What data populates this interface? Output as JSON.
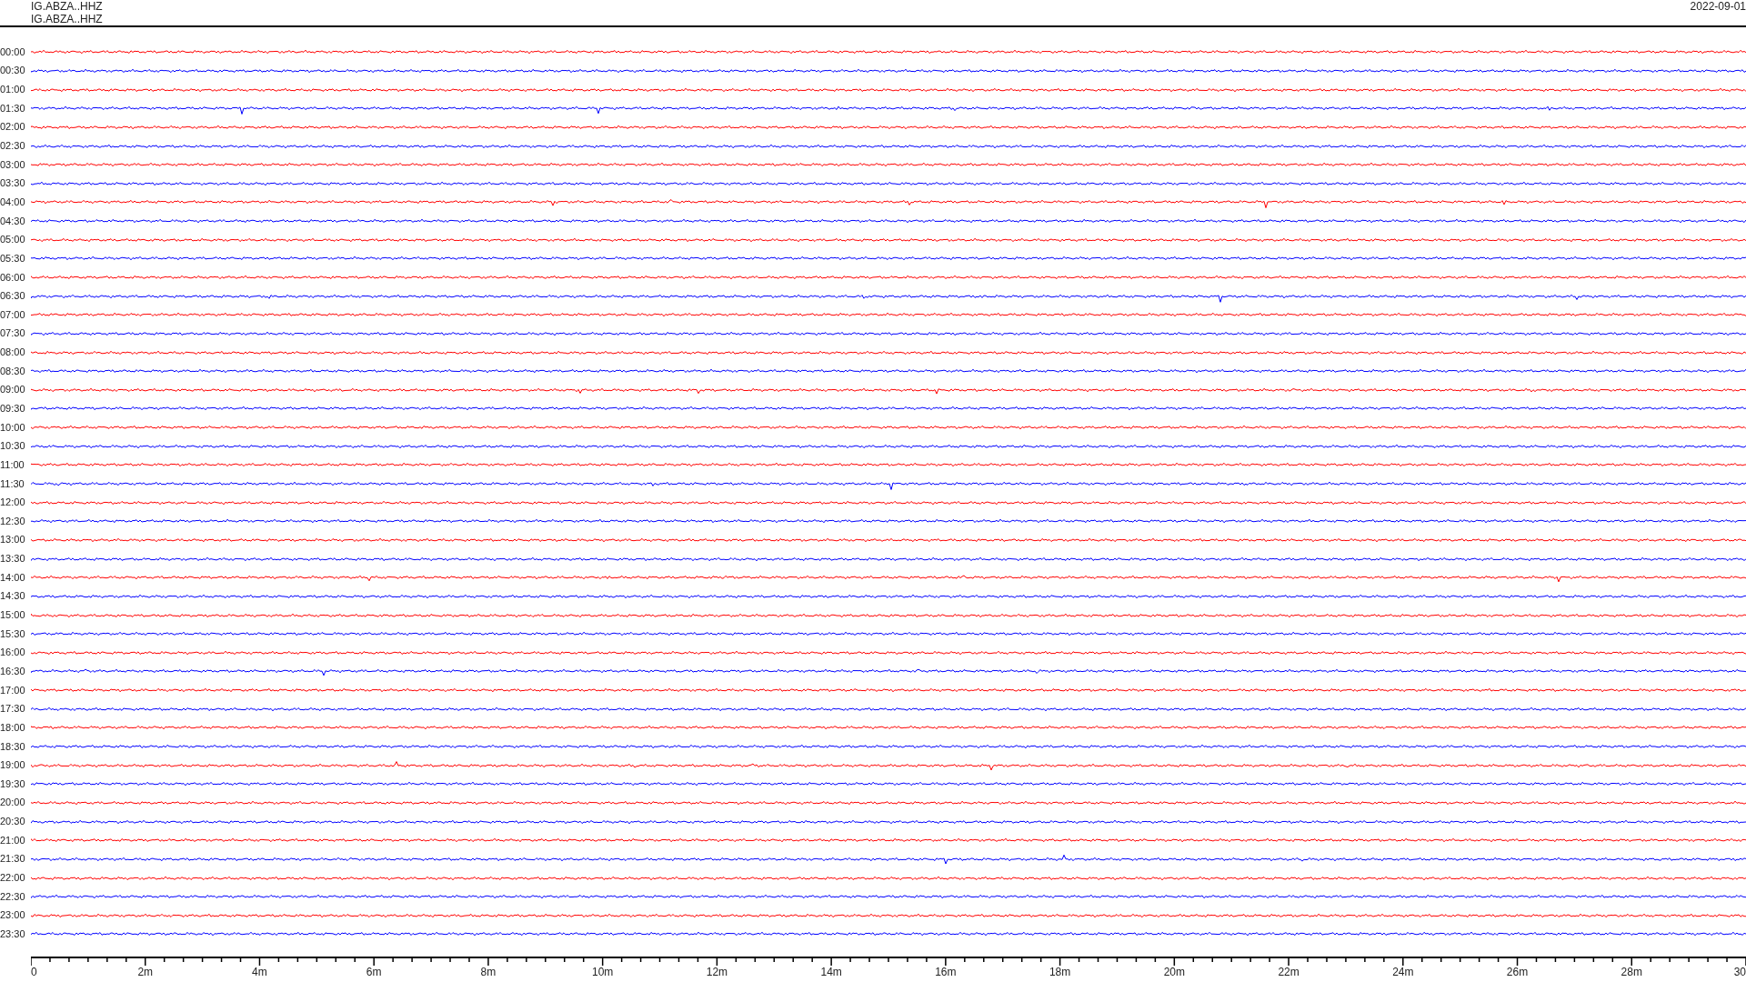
{
  "header": {
    "stations": [
      "IG.ABZA..HHZ",
      "IG.ABZA..HHZ"
    ],
    "date": "2022-09-01"
  },
  "rows": [
    {
      "label": "00:00",
      "color": "#ff0000"
    },
    {
      "label": "00:30",
      "color": "#0000ff"
    },
    {
      "label": "01:00",
      "color": "#ff0000"
    },
    {
      "label": "01:30",
      "color": "#0000ff"
    },
    {
      "label": "02:00",
      "color": "#ff0000"
    },
    {
      "label": "02:30",
      "color": "#0000ff"
    },
    {
      "label": "03:00",
      "color": "#ff0000"
    },
    {
      "label": "03:30",
      "color": "#0000ff"
    },
    {
      "label": "04:00",
      "color": "#ff0000"
    },
    {
      "label": "04:30",
      "color": "#0000ff"
    },
    {
      "label": "05:00",
      "color": "#ff0000"
    },
    {
      "label": "05:30",
      "color": "#0000ff"
    },
    {
      "label": "06:00",
      "color": "#ff0000"
    },
    {
      "label": "06:30",
      "color": "#0000ff"
    },
    {
      "label": "07:00",
      "color": "#ff0000"
    },
    {
      "label": "07:30",
      "color": "#0000ff"
    },
    {
      "label": "08:00",
      "color": "#ff0000"
    },
    {
      "label": "08:30",
      "color": "#0000ff"
    },
    {
      "label": "09:00",
      "color": "#ff0000"
    },
    {
      "label": "09:30",
      "color": "#0000ff"
    },
    {
      "label": "10:00",
      "color": "#ff0000"
    },
    {
      "label": "10:30",
      "color": "#0000ff"
    },
    {
      "label": "11:00",
      "color": "#ff0000"
    },
    {
      "label": "11:30",
      "color": "#0000ff"
    },
    {
      "label": "12:00",
      "color": "#ff0000"
    },
    {
      "label": "12:30",
      "color": "#0000ff"
    },
    {
      "label": "13:00",
      "color": "#ff0000"
    },
    {
      "label": "13:30",
      "color": "#0000ff"
    },
    {
      "label": "14:00",
      "color": "#ff0000"
    },
    {
      "label": "14:30",
      "color": "#0000ff"
    },
    {
      "label": "15:00",
      "color": "#ff0000"
    },
    {
      "label": "15:30",
      "color": "#0000ff"
    },
    {
      "label": "16:00",
      "color": "#ff0000"
    },
    {
      "label": "16:30",
      "color": "#0000ff"
    },
    {
      "label": "17:00",
      "color": "#ff0000"
    },
    {
      "label": "17:30",
      "color": "#0000ff"
    },
    {
      "label": "18:00",
      "color": "#ff0000"
    },
    {
      "label": "18:30",
      "color": "#0000ff"
    },
    {
      "label": "19:00",
      "color": "#ff0000"
    },
    {
      "label": "19:30",
      "color": "#0000ff"
    },
    {
      "label": "20:00",
      "color": "#ff0000"
    },
    {
      "label": "20:30",
      "color": "#0000ff"
    },
    {
      "label": "21:00",
      "color": "#ff0000"
    },
    {
      "label": "21:30",
      "color": "#0000ff"
    },
    {
      "label": "22:00",
      "color": "#ff0000"
    },
    {
      "label": "22:30",
      "color": "#0000ff"
    },
    {
      "label": "23:00",
      "color": "#ff0000"
    },
    {
      "label": "23:30",
      "color": "#0000ff"
    }
  ],
  "axis": {
    "labels": [
      "0",
      "2m",
      "4m",
      "6m",
      "8m",
      "10m",
      "12m",
      "14m",
      "16m",
      "18m",
      "20m",
      "22m",
      "24m",
      "26m",
      "28m",
      "30"
    ]
  }
}
